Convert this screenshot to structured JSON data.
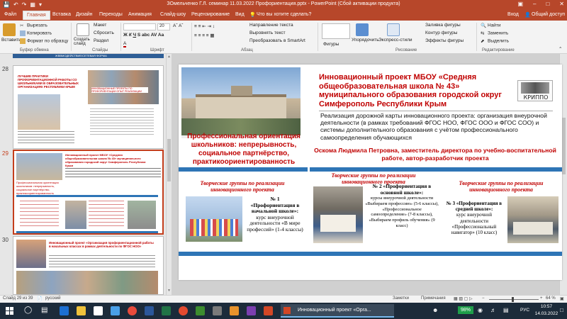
{
  "titlebar": {
    "title": "ЗОмельченко Г.Л. семинар 11.03.2022 Профориентация.pptx - PowerPoint (Сбой активации продукта)"
  },
  "tabs": {
    "items": [
      "Файл",
      "Главная",
      "Вставка",
      "Дизайн",
      "Переходы",
      "Анимация",
      "Слайд-шоу",
      "Рецензирование",
      "Вид"
    ],
    "search": "Что вы хотите сделать?",
    "login": "Вход",
    "share": "Общий доступ"
  },
  "ribbon": {
    "paste": "Вставить",
    "cut": "Вырезать",
    "copy": "Копировать",
    "format_painter": "Формат по образцу",
    "clipboard_group": "Буфер обмена",
    "new_slide": "Создать слайд",
    "layout": "Макет",
    "reset": "Сбросить",
    "section": "Раздел",
    "slides_group": "Слайды",
    "font_size": "20",
    "font_group": "Шрифт",
    "text_direction": "Направление текста",
    "align_text": "Выровнять текст",
    "smartart": "Преобразовать в SmartArt",
    "paragraph_group": "Абзац",
    "shapes": "Фигуры",
    "arrange": "Упорядочить",
    "quick_styles": "Экспресс-стили",
    "shape_fill": "Заливка фигуры",
    "shape_outline": "Контур фигуры",
    "shape_effects": "Эффекты фигуры",
    "drawing_group": "Рисование",
    "find": "Найти",
    "replace": "Заменить",
    "select": "Выделить",
    "editing_group": "Редактирование"
  },
  "thumbnails": {
    "top_strip": "ЖВВМОДЕЙСТВИЕ/СЕТЕВАЯ ФОРМА",
    "s28_num": "28",
    "s28_title": "ЛУЧШИЕ ПРАКТИКИ ПРОФОРИЕНТАЦИОННОЙ РАБОТЫ СО ШКОЛЬНИКАМИ В ОБРАЗОВАТЕЛЬНЫХ ОРГАНИЗАЦИЯХ РЕСПУБЛИКИ КРЫМ",
    "s28_sub": "ИННОВАЦИОННЫЕ ПРОЕКТЫ ПО ПРОФОРИЕНТАЦИИ ОПЫТ РЕАЛИЗАЦИИ",
    "s29_num": "29",
    "s29_title": "Инновационный проект МБОУ «Средняя общеобразовательная школа № 43» муниципального образования городской округ Симферополь Республики Крым",
    "s29_left": "Профессиональная ориентация школьников: непрерывность, социальное партнёрство, практикоориентированность",
    "s30_num": "30",
    "s30_title": "Инновационный проект «Организация профориентационной работы в начальных классах в рамках деятельности по ФГОС НОО»"
  },
  "slide": {
    "title": "Инновационный проект МБОУ «Средняя общеобразовательная школа № 43» муниципального образования городской округ Симферополь Республики Крым",
    "logo_text": "КРИППО",
    "description": "Реализация дорожной карты инновационного проекта: организация внеурочной деятельности (в рамках требований ФГОС НОО, ФГОС ООО и ФГОС СОО) и системы дополнительного образования с учётом профессионального самоопределения обучающихся",
    "left_heading": "Профессиональная ориентация школьников: непрерывность, социальное партнёрство, практикоориентированность",
    "author": "Оскома Людмила Петровна, заместитель директора по учебно-воспитательной работе, автор-разработчик проекта",
    "groups_heading": "Творческие группы по реализации инновационного проекта",
    "group1_num": "№ 1",
    "group1_name": "«Профориентация в начальной школе»:",
    "group1_text": "курс внеурочной деятельности «В мире профессий» (1-4 классы)",
    "group2_heading": "Творческие группы по реализации инновационного проекта",
    "group2_name": "№ 2 «Профориентация в основной школе»:",
    "group2_text": "курсы внеурочной деятельности «Выбираем профессию» (5-6 классы), «Профессиональное самоопределение» (7-8 классы), «Выбираем профиль обучения» (9 класс)",
    "group3_heading": "Творческие группы по реализации инновационного проекта",
    "group3_name": "№ 3 «Профориентация в средней школе»:",
    "group3_text": "курс внеурочной деятельности «Профессиональный навигатор» (10 класс)"
  },
  "status": {
    "slide": "Слайд 29 из 39",
    "language": "русский",
    "notes": "Заметки",
    "comments": "Примечания",
    "zoom": "64 %"
  },
  "taskbar": {
    "app": "Инновационный проект «Орга...",
    "battery": "98%",
    "lang": "РУС",
    "time": "10:57",
    "date": "14.03.2022"
  },
  "colors": {
    "accent": "#b7472a",
    "slide_red": "#c00000",
    "slide_blue": "#2e75b6"
  }
}
